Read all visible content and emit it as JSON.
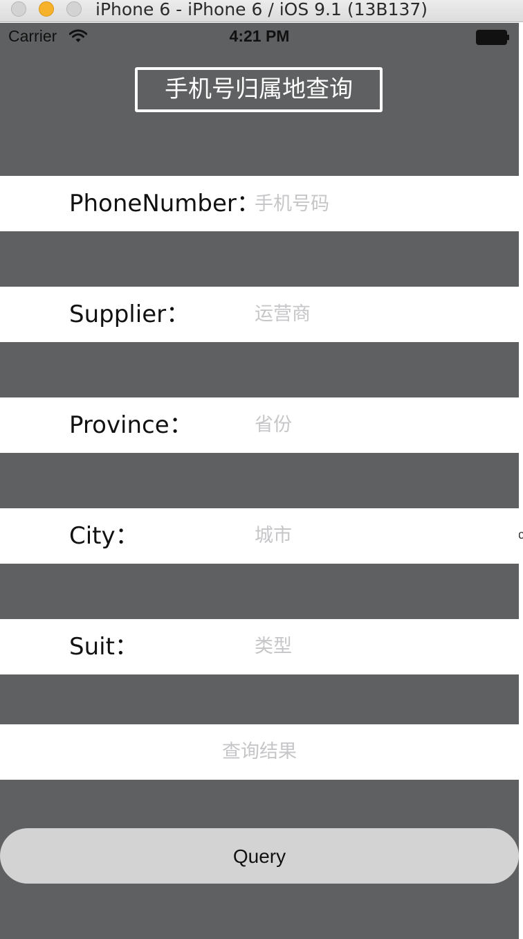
{
  "window": {
    "title": "iPhone 6 - iPhone 6 / iOS 9.1 (13B137)"
  },
  "statusbar": {
    "carrier": "Carrier",
    "time": "4:21 PM"
  },
  "header": {
    "title": "手机号归属地查询"
  },
  "form": {
    "phone": {
      "label": "PhoneNumber：",
      "placeholder": "手机号码"
    },
    "supplier": {
      "label": "Supplier：",
      "value": "运营商"
    },
    "province": {
      "label": "Province：",
      "value": "省份"
    },
    "city": {
      "label": "City：",
      "value": "城市"
    },
    "suit": {
      "label": "Suit：",
      "value": "类型"
    }
  },
  "result": {
    "text": "查询结果"
  },
  "actions": {
    "query_label": "Query"
  },
  "colors": {
    "screen_background": "#5f6061",
    "row_background": "#ffffff",
    "placeholder": "#c6c6c9",
    "button_background": "#d3d3d3",
    "minimize_button": "#f6b22a"
  }
}
